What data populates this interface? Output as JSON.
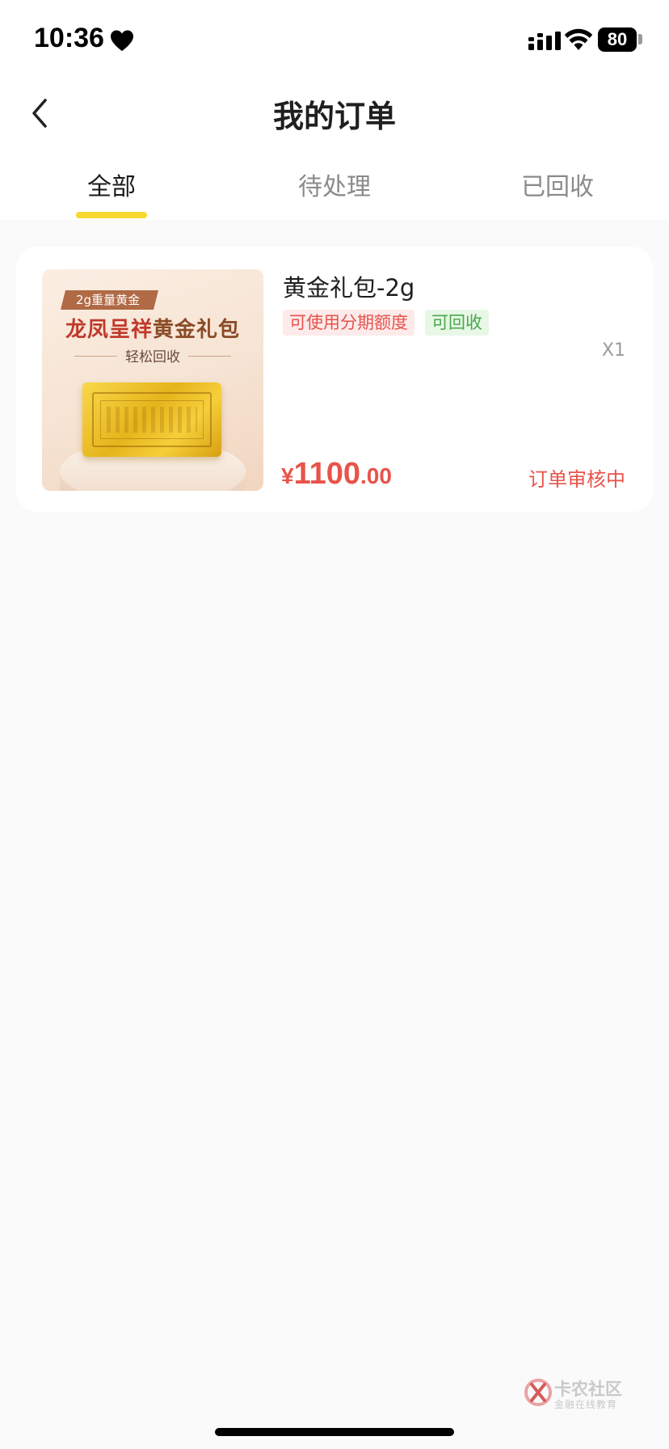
{
  "status_bar": {
    "time": "10:36",
    "battery": "80",
    "icons": [
      "heart-icon",
      "cellular-signal-icon",
      "wifi-icon",
      "battery-icon"
    ]
  },
  "header": {
    "back_icon": "chevron-left-icon",
    "title": "我的订单"
  },
  "tabs": [
    {
      "label": "全部",
      "active": true
    },
    {
      "label": "待处理",
      "active": false
    },
    {
      "label": "已回收",
      "active": false
    }
  ],
  "accent_colors": {
    "tab_indicator": "#f7d930",
    "price": "#e8534a",
    "tag_installment_bg": "#fdeaea",
    "tag_recyclable_bg": "#e8f7e6"
  },
  "order": {
    "image": {
      "badge": "2g重量黄金",
      "title_red": "龙凤呈祥",
      "title_brown": "黄金礼包",
      "subtitle": "轻松回收"
    },
    "product_name": "黄金礼包-2g",
    "tags": [
      "可使用分期额度",
      "可回收"
    ],
    "quantity": "X1",
    "price": {
      "currency": "¥",
      "integer": "1100",
      "decimal": ".00"
    },
    "status": "订单审核中"
  },
  "watermark": {
    "title": "卡农社区",
    "subtitle": "金融在线教育"
  }
}
